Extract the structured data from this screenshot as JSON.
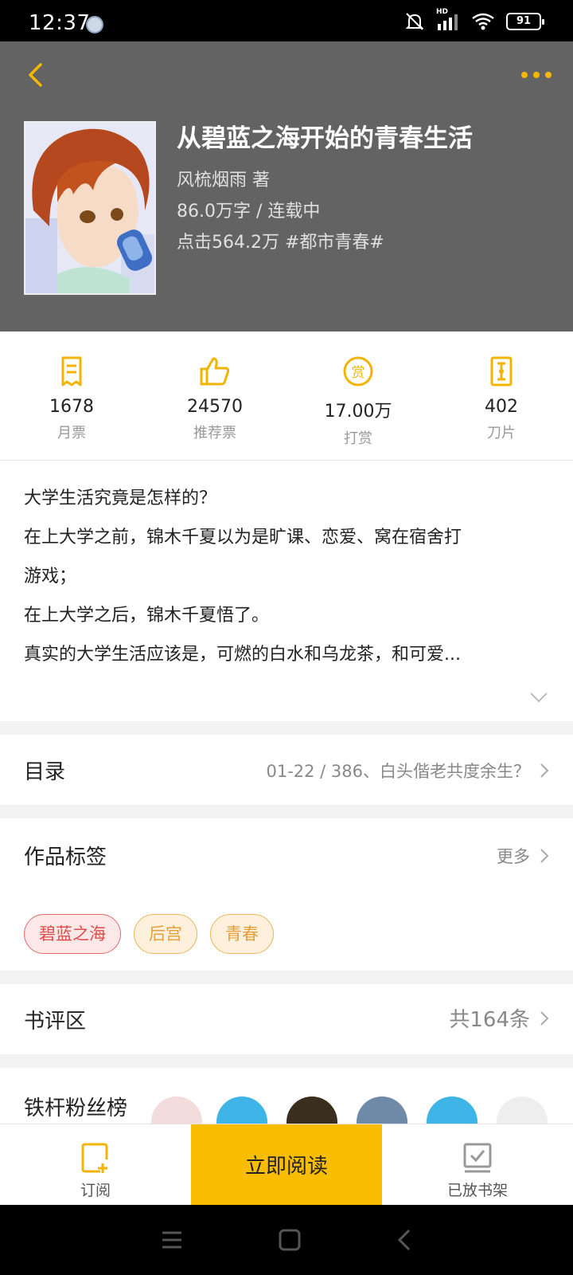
{
  "status_bar": {
    "time": "12:37",
    "battery": "91",
    "network": "HD"
  },
  "header": {
    "title": "从碧蓝之海开始的青春生活",
    "author_line": "风梳烟雨  著",
    "words_status": "86.0万字 / 连载中",
    "clicks_genre": "点击564.2万  #都市青春#"
  },
  "stats": [
    {
      "value": "1678",
      "label": "月票",
      "icon": "ticket-icon"
    },
    {
      "value": "24570",
      "label": "推荐票",
      "icon": "thumbs-up-icon"
    },
    {
      "value": "17.00万",
      "label": "打赏",
      "icon": "reward-icon"
    },
    {
      "value": "402",
      "label": "刀片",
      "icon": "blade-icon"
    }
  ],
  "synopsis": [
    "大学生活究竟是怎样的？",
    "在上大学之前，锦木千夏以为是旷课、恋爱、窝在宿舍打",
    "游戏；",
    "在上大学之后，锦木千夏悟了。",
    "真实的大学生活应该是，可燃的白水和乌龙茶，和可爱..."
  ],
  "catalog": {
    "title": "目录",
    "latest": "01-22 / 386、白头偕老共度余生？"
  },
  "tags_section": {
    "title": "作品标签",
    "more": "更多",
    "tags": [
      "碧蓝之海",
      "后宫",
      "青春"
    ]
  },
  "reviews": {
    "title": "书评区",
    "count": "共164条"
  },
  "fans": {
    "title": "铁杆粉丝榜"
  },
  "bottom_bar": {
    "subscribe": "订阅",
    "read_now": "立即阅读",
    "shelf": "已放书架"
  },
  "colors": {
    "accent": "#f8bd00",
    "header_bg": "#636363",
    "tag_red": "#e04b4b",
    "tag_orange": "#e5a03a"
  }
}
